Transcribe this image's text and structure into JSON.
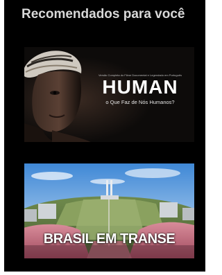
{
  "section": {
    "title": "Recomendados para você"
  },
  "cards": [
    {
      "title": "HUMAN",
      "subtitle": "Versão Completa do Filme Documental e Legendado em Português",
      "tagline": "o Que Faz de Nós Humanos?"
    },
    {
      "title": "BRASIL EM TRANSE"
    }
  ],
  "colors": {
    "panel_background": "#000000",
    "title_text": "#d8d8d8",
    "card_text": "#ffffff"
  }
}
